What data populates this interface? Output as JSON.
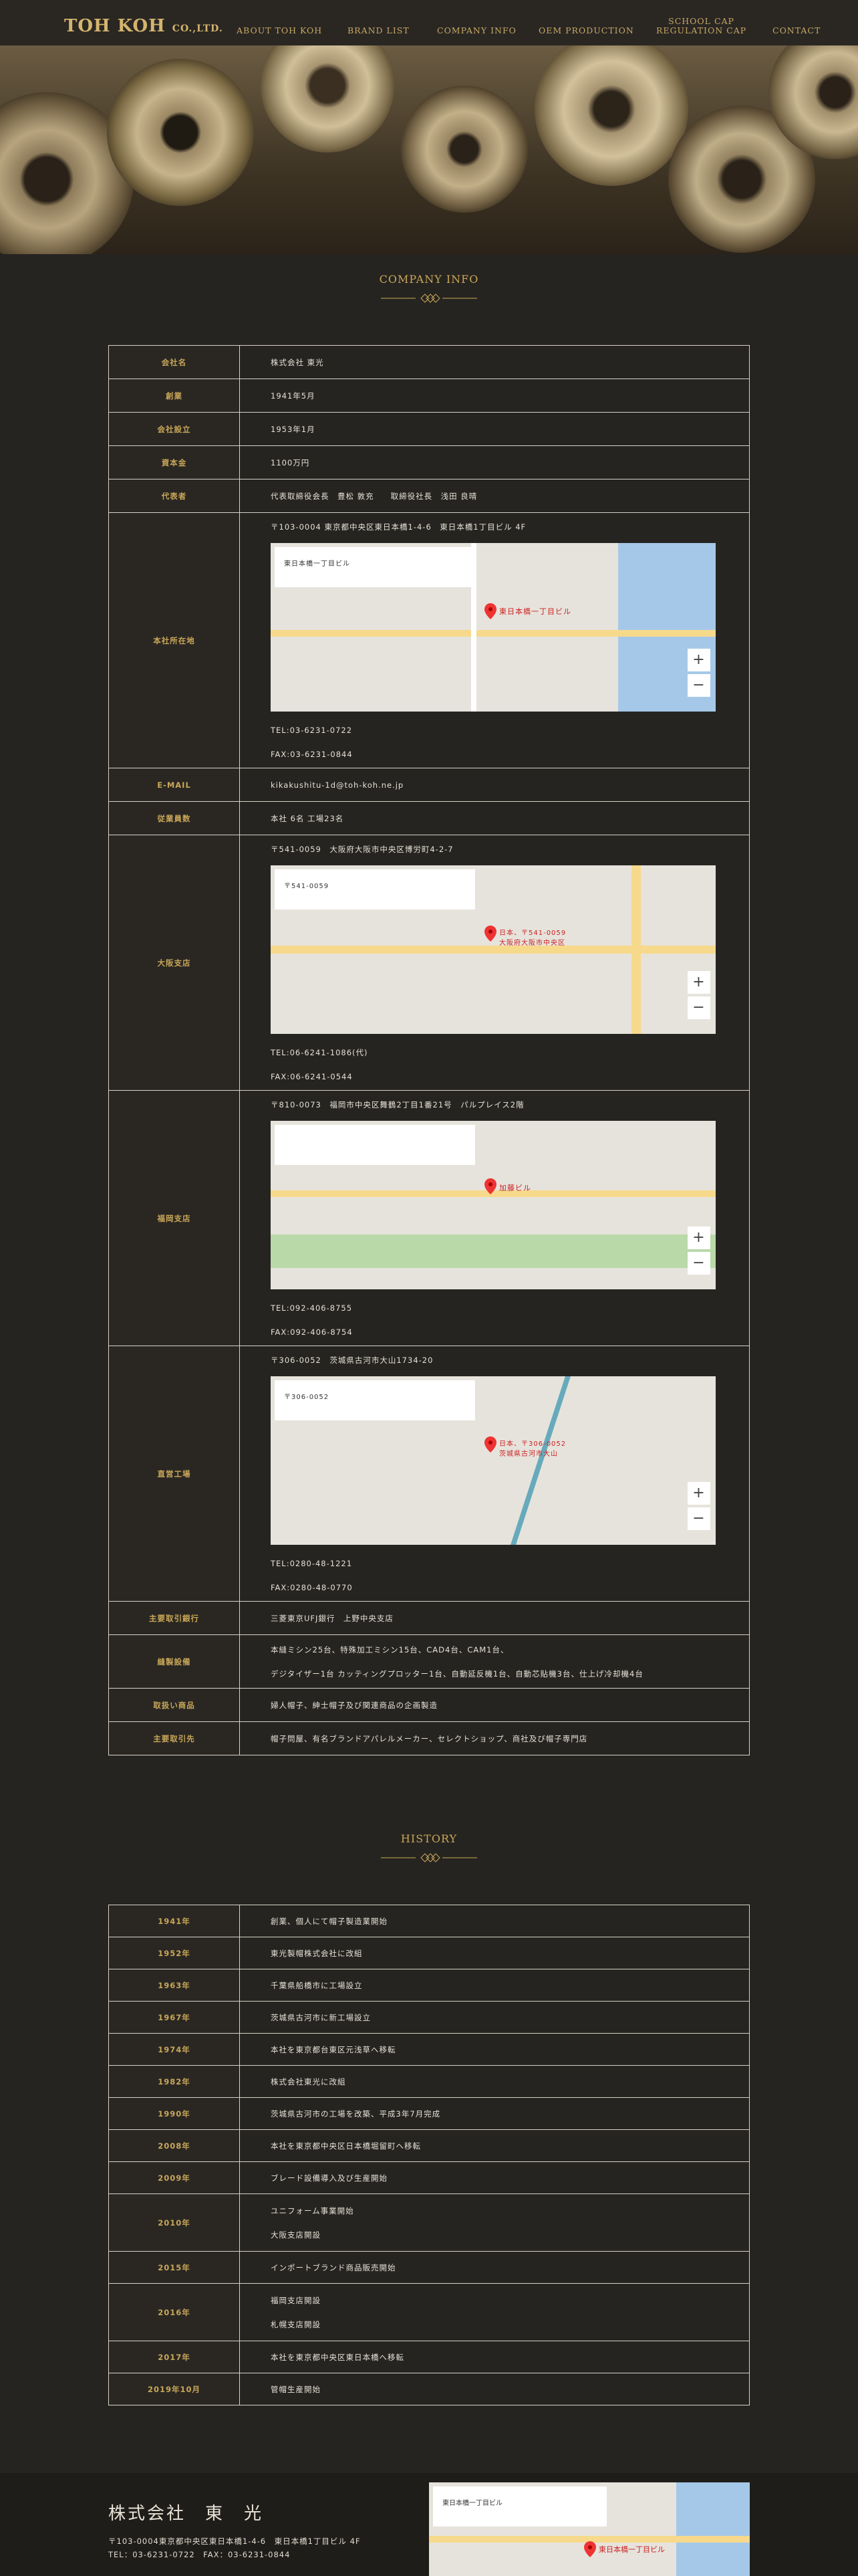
{
  "header": {
    "logo_main": "TOH KOH",
    "logo_suffix": "CO.,LTD.",
    "nav": [
      "ABOUT TOH KOH",
      "BRAND LIST",
      "COMPANY INFO",
      "OEM PRODUCTION",
      "SCHOOL CAP",
      "REGULATION CAP",
      "CONTACT"
    ]
  },
  "company": {
    "title": "COMPANY INFO",
    "rows": [
      {
        "k": "会社名",
        "v": "株式会社 東光"
      },
      {
        "k": "創業",
        "v": "1941年5月"
      },
      {
        "k": "会社設立",
        "v": "1953年1月"
      },
      {
        "k": "資本金",
        "v": "1100万円"
      },
      {
        "k": "代表者",
        "v": "代表取締役会長　豊松 敦充　　取締役社長　浅田 良晴"
      }
    ],
    "hq": {
      "k": "本社所在地",
      "addr": "〒103-0004 東京都中央区東日本橋1-4-6　東日本橋1丁目ビル 4F",
      "map_label": "東日本橋一丁目ビル",
      "tel": "TEL:03-6231-0722",
      "fax": "FAX:03-6231-0844"
    },
    "email": {
      "k": "E-MAIL",
      "v": "kikakushitu-1d@toh-koh.ne.jp"
    },
    "staff": {
      "k": "従業員数",
      "v": "本社 6名 工場23名"
    },
    "osaka": {
      "k": "大阪支店",
      "addr": "〒541-0059　大阪府大阪市中央区博労町4-2-7",
      "map_card": "〒541-0059",
      "map_label": "日本、〒541-0059 大阪府大阪市中央区",
      "tel": "TEL:06-6241-1086(代)",
      "fax": "FAX:06-6241-0544"
    },
    "fukuoka": {
      "k": "福岡支店",
      "addr": "〒810-0073　福岡市中央区舞鶴2丁目1番21号　パルプレイス2階",
      "map_label": "加藤ビル",
      "tel": "TEL:092-406-8755",
      "fax": "FAX:092-406-8754"
    },
    "factory": {
      "k": "直営工場",
      "addr": "〒306-0052　茨城県古河市大山1734-20",
      "map_card": "〒306-0052",
      "map_label": "日本、〒306-0052 茨城県古河市大山",
      "tel": "TEL:0280-48-1221",
      "fax": "FAX:0280-48-0770"
    },
    "bank": {
      "k": "主要取引銀行",
      "v": "三菱東京UFJ銀行　上野中央支店"
    },
    "equipment": {
      "k": "縫製設備",
      "v1": "本縫ミシン25台、特殊加工ミシン15台、CAD4台、CAM1台、",
      "v2": "デジタイザー1台 カッティングプロッター1台、自動延反機1台、自動芯貼機3台、仕上げ冷却機4台"
    },
    "products": {
      "k": "取扱い商品",
      "v": "婦人帽子、紳士帽子及び関連商品の企画製造"
    },
    "clients": {
      "k": "主要取引先",
      "v": "帽子問屋、有名ブランドアパレルメーカー、セレクトショップ、商社及び帽子専門店"
    }
  },
  "history": {
    "title": "HISTORY",
    "rows": [
      {
        "y": "1941年",
        "v": [
          "創業、個人にて帽子製造業開始"
        ]
      },
      {
        "y": "1952年",
        "v": [
          "東光製帽株式会社に改組"
        ]
      },
      {
        "y": "1963年",
        "v": [
          "千葉県船橋市に工場設立"
        ]
      },
      {
        "y": "1967年",
        "v": [
          "茨城県古河市に新工場設立"
        ]
      },
      {
        "y": "1974年",
        "v": [
          "本社を東京都台東区元浅草へ移転"
        ]
      },
      {
        "y": "1982年",
        "v": [
          "株式会社東光に改組"
        ]
      },
      {
        "y": "1990年",
        "v": [
          "茨城県古河市の工場を改築、平成3年7月完成"
        ]
      },
      {
        "y": "2008年",
        "v": [
          "本社を東京都中央区日本橋堀留町へ移転"
        ]
      },
      {
        "y": "2009年",
        "v": [
          "ブレード設備導入及び生産開始"
        ]
      },
      {
        "y": "2010年",
        "v": [
          "ユニフォーム事業開始",
          "大阪支店開設"
        ]
      },
      {
        "y": "2015年",
        "v": [
          "インポートブランド商品販売開始"
        ]
      },
      {
        "y": "2016年",
        "v": [
          "福岡支店開設",
          "札幌支店開設"
        ]
      },
      {
        "y": "2017年",
        "v": [
          "本社を東京都中央区東日本橋へ移転"
        ]
      },
      {
        "y": "2019年10月",
        "v": [
          "管帽生産開始"
        ]
      }
    ]
  },
  "footer": {
    "company_name": "株式会社　東　光",
    "address": "〒103-0004東京都中央区東日本橋1-4-6　東日本橋1丁目ビル 4F",
    "contact": "TEL：03-6231-0722　FAX：03-6231-0844",
    "map_label": "東日本橋一丁目ビル"
  },
  "colors": {
    "accent": "#c9a758",
    "bg": "#262421",
    "border": "#d7d2c8"
  }
}
